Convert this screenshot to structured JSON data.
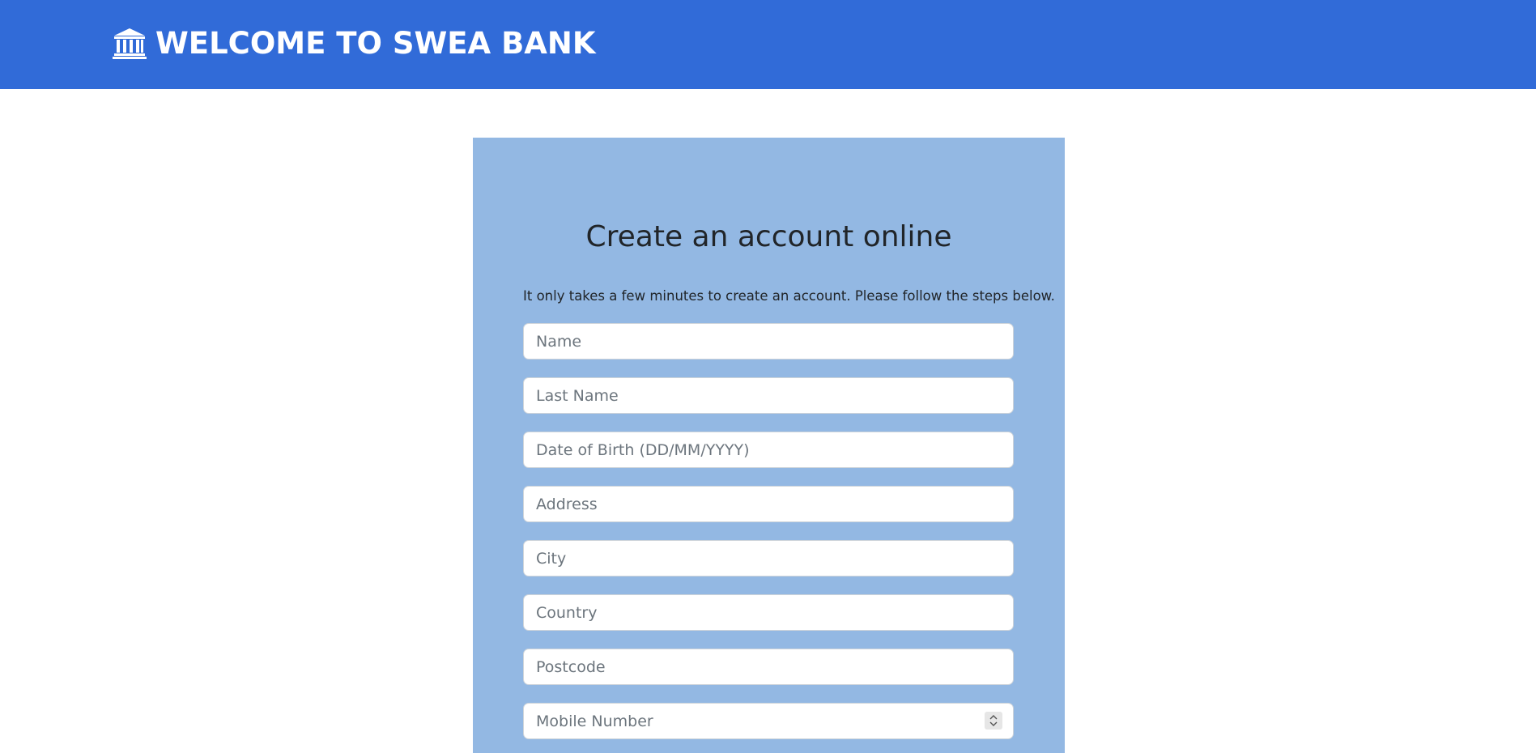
{
  "header": {
    "title": "WELCOME TO SWEA BANK",
    "icon": "bank-icon",
    "background_color": "#316bd8"
  },
  "form": {
    "heading": "Create an account online",
    "intro": "It only takes a few minutes to create an account. Please follow the steps below.",
    "background_color": "#93b8e3",
    "fields": {
      "name": {
        "placeholder": "Name",
        "value": ""
      },
      "last_name": {
        "placeholder": "Last Name",
        "value": ""
      },
      "dob": {
        "placeholder": "Date of Birth (DD/MM/YYYY)",
        "value": ""
      },
      "address": {
        "placeholder": "Address",
        "value": ""
      },
      "city": {
        "placeholder": "City",
        "value": ""
      },
      "country": {
        "placeholder": "Country",
        "value": ""
      },
      "postcode": {
        "placeholder": "Postcode",
        "value": ""
      },
      "mobile": {
        "placeholder": "Mobile Number",
        "value": ""
      }
    }
  }
}
